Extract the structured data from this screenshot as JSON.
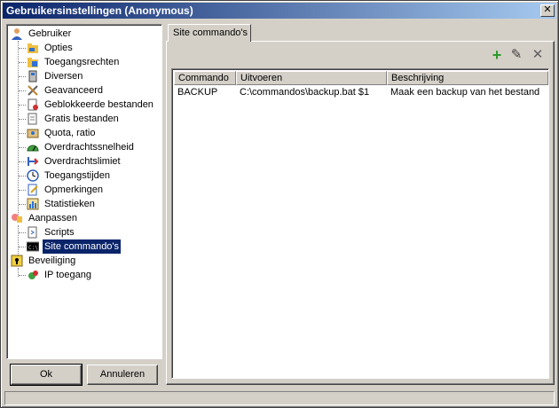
{
  "window": {
    "title": "Gebruikersinstellingen (Anonymous)",
    "close_glyph": "✕"
  },
  "tree": {
    "groups": [
      {
        "label": "Gebruiker",
        "icon": "user-icon"
      },
      {
        "label": "Aanpassen",
        "icon": "customize-icon"
      },
      {
        "label": "Beveiliging",
        "icon": "security-icon"
      }
    ],
    "gebruiker_items": [
      {
        "label": "Opties",
        "icon": "folder-options-icon"
      },
      {
        "label": "Toegangsrechten",
        "icon": "folder-rights-icon"
      },
      {
        "label": "Diversen",
        "icon": "device-icon"
      },
      {
        "label": "Geavanceerd",
        "icon": "tools-icon"
      },
      {
        "label": "Geblokkeerde bestanden",
        "icon": "blocked-file-icon"
      },
      {
        "label": "Gratis bestanden",
        "icon": "free-file-icon"
      },
      {
        "label": "Quota, ratio",
        "icon": "quota-icon"
      },
      {
        "label": "Overdrachtssnelheid",
        "icon": "speed-gauge-icon"
      },
      {
        "label": "Overdrachtslimiet",
        "icon": "limit-icon"
      },
      {
        "label": "Toegangstijden",
        "icon": "clock-icon"
      },
      {
        "label": "Opmerkingen",
        "icon": "notes-icon"
      },
      {
        "label": "Statistieken",
        "icon": "stats-icon"
      }
    ],
    "aanpassen_items": [
      {
        "label": "Scripts",
        "icon": "script-icon"
      },
      {
        "label": "Site commando's",
        "icon": "command-icon"
      }
    ],
    "beveiliging_items": [
      {
        "label": "IP toegang",
        "icon": "ip-access-icon"
      }
    ]
  },
  "buttons": {
    "ok": "Ok",
    "cancel": "Annuleren"
  },
  "tab": {
    "label": "Site commando's"
  },
  "toolbar": {
    "add_glyph": "+",
    "edit_glyph": "✎",
    "delete_glyph": "✕"
  },
  "table": {
    "columns": [
      "Commando",
      "Uitvoeren",
      "Beschrijving"
    ],
    "rows": [
      [
        "BACKUP",
        "C:\\commandos\\backup.bat $1",
        "Maak een backup van het bestand"
      ]
    ]
  },
  "colors": {
    "titlebar_start": "#0a246a",
    "titlebar_end": "#a6caf0",
    "selection": "#0a246a",
    "add_icon": "#2a9a2a",
    "delete_icon": "#606060"
  }
}
